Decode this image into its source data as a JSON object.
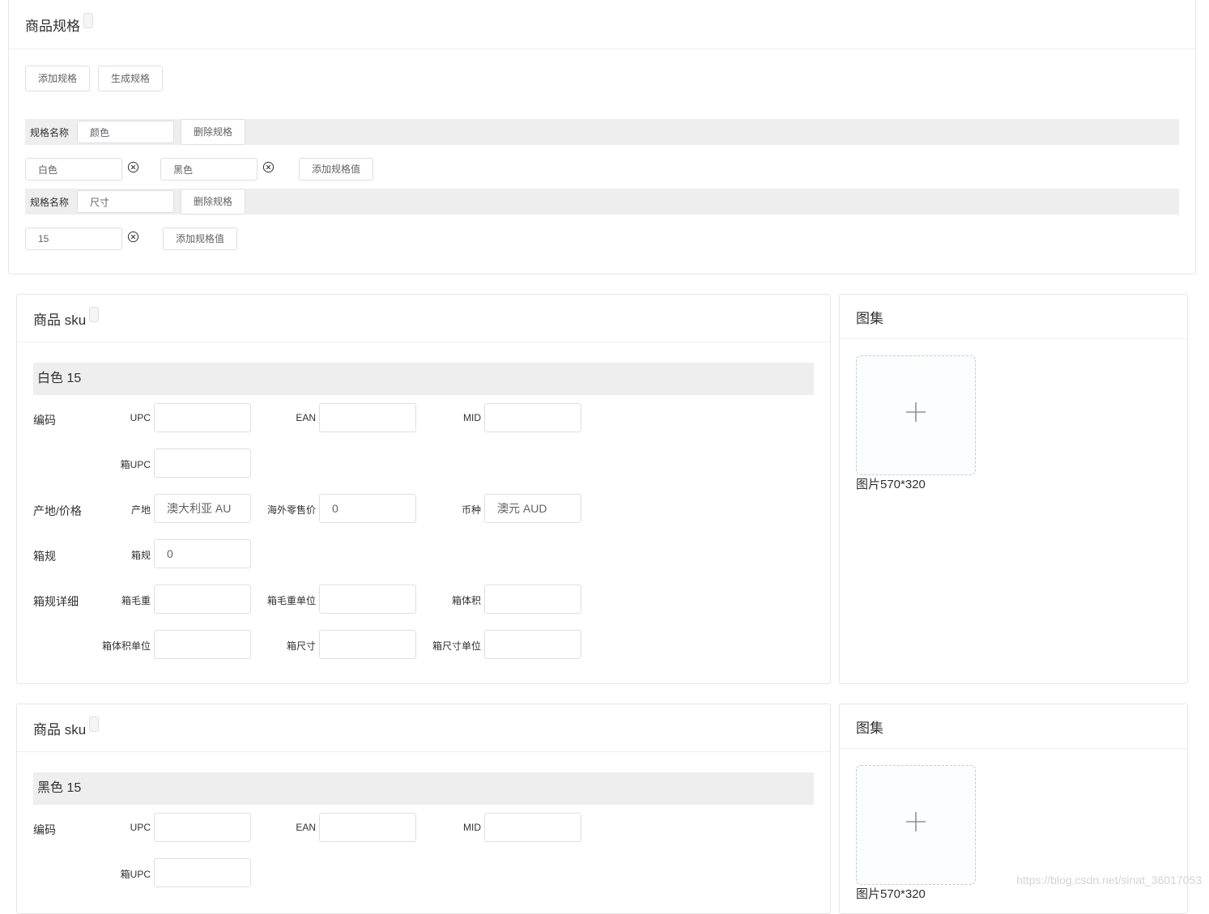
{
  "spec_section": {
    "title": "商品规格",
    "add_spec_button": "添加规格",
    "generate_spec_button": "生成规格",
    "spec_name_label": "规格名称",
    "delete_spec_button": "删除规格",
    "add_value_button": "添加规格值",
    "specs": [
      {
        "name": "颜色",
        "values": [
          "白色",
          "黑色"
        ]
      },
      {
        "name": "尺寸",
        "values": [
          "15"
        ]
      }
    ]
  },
  "sku_cards": [
    {
      "title": "商品 sku",
      "variant": "白色 15",
      "groups": {
        "code": "编码",
        "origin_price": "产地/价格",
        "box_spec": "箱规",
        "box_detail": "箱规详细"
      },
      "fields": {
        "upc": {
          "label": "UPC",
          "value": ""
        },
        "ean": {
          "label": "EAN",
          "value": ""
        },
        "mid": {
          "label": "MID",
          "value": ""
        },
        "box_upc": {
          "label": "箱UPC",
          "value": ""
        },
        "origin": {
          "label": "产地",
          "value": "澳大利亚 AU"
        },
        "retail_price": {
          "label": "海外零售价",
          "value": "0"
        },
        "currency": {
          "label": "币种",
          "value": "澳元 AUD"
        },
        "box_spec": {
          "label": "箱规",
          "value": "0"
        },
        "box_gross_weight": {
          "label": "箱毛重",
          "value": ""
        },
        "box_weight_unit": {
          "label": "箱毛重单位",
          "value": ""
        },
        "box_volume": {
          "label": "箱体积",
          "value": ""
        },
        "box_volume_unit": {
          "label": "箱体积单位",
          "value": ""
        },
        "box_size": {
          "label": "箱尺寸",
          "value": ""
        },
        "box_size_unit": {
          "label": "箱尺寸单位",
          "value": ""
        }
      },
      "gallery": {
        "title": "图集",
        "hint": "图片570*320"
      }
    },
    {
      "title": "商品 sku",
      "variant": "黑色 15",
      "groups": {
        "code": "编码"
      },
      "fields": {
        "upc": {
          "label": "UPC",
          "value": ""
        },
        "ean": {
          "label": "EAN",
          "value": ""
        },
        "mid": {
          "label": "MID",
          "value": ""
        },
        "box_upc": {
          "label": "箱UPC",
          "value": ""
        }
      },
      "gallery": {
        "title": "图集",
        "hint": "图片570*320"
      }
    }
  ],
  "watermark": "https://blog.csdn.net/sinat_36017053"
}
